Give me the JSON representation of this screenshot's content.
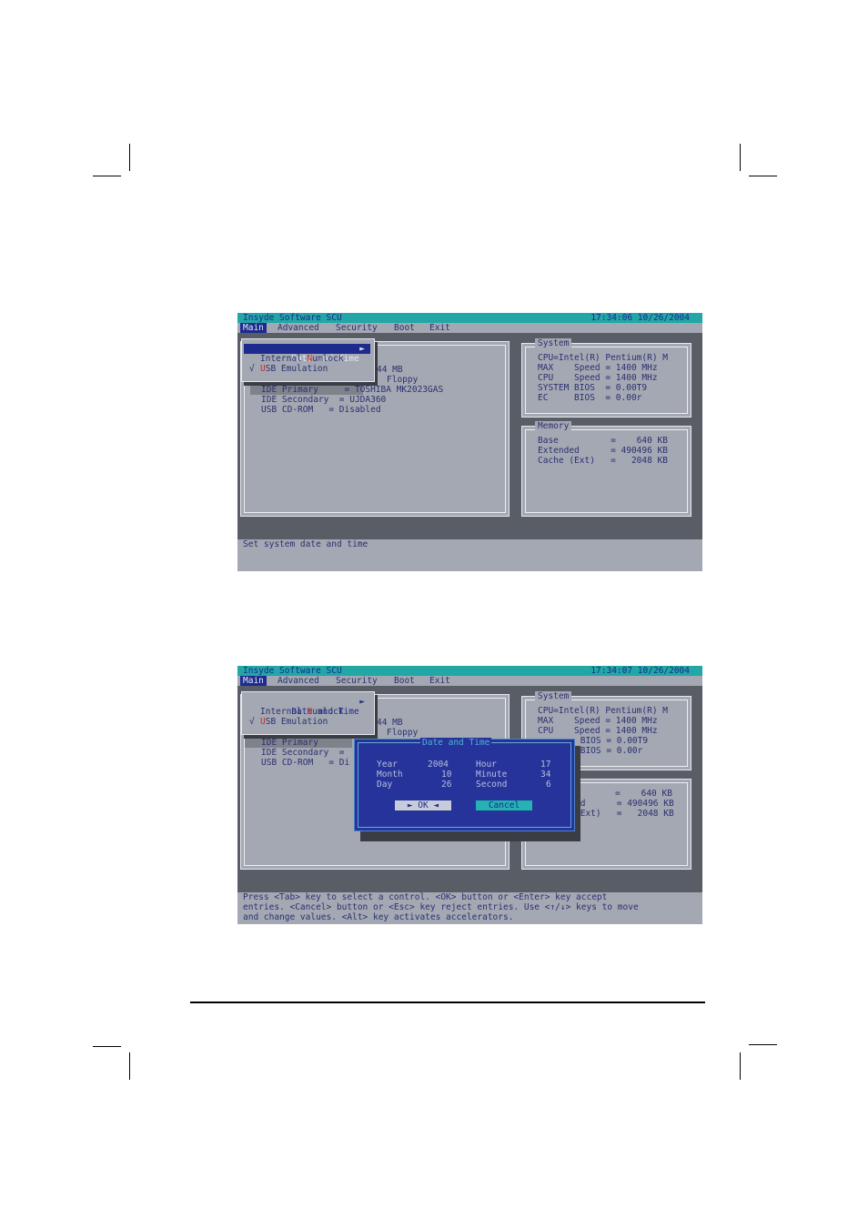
{
  "screen1": {
    "app_title": "Insyde Software SCU",
    "clock": "17:34:06  10/26/2004",
    "menu": [
      "Main",
      "Advanced",
      "Security",
      "Boot",
      "Exit"
    ],
    "dropdown": {
      "date_time": "Date and Time",
      "arrow": "►",
      "numlock_a": "Internal ",
      "numlock_b": "N",
      "numlock_c": "umlock",
      "check": "√",
      "usb_a": "U",
      "usb_b": "SB Emulation"
    },
    "left_rows": [
      "44 MB",
      "Floppy",
      "IDE Primary     = TOSHIBA MK2023GAS",
      "IDE Secondary  = UJDA360",
      "USB CD-ROM   = Disabled"
    ],
    "system": {
      "title": "System",
      "rows": [
        "CPU=Intel(R) Pentium(R) M",
        "MAX    Speed = 1400 MHz",
        "CPU    Speed = 1400 MHz",
        "SYSTEM BIOS  = 0.00T9",
        "EC     BIOS  = 0.00r"
      ]
    },
    "memory": {
      "title": "Memory",
      "rows": [
        "Base          =    640 KB",
        "Extended      = 490496 KB",
        "Cache (Ext)   =   2048 KB"
      ]
    },
    "status": [
      "Set system date and time"
    ]
  },
  "screen2": {
    "app_title": "Insyde Software SCU",
    "clock": "17:34:07  10/26/2004",
    "menu": [
      "Main",
      "Advanced",
      "Security",
      "Boot",
      "Exit"
    ],
    "left_rows": [
      "44 MB",
      "Floppy",
      "IDE Primary",
      "IDE Secondary  =",
      "USB CD-ROM   = Di"
    ],
    "system": {
      "title": "System",
      "rows": [
        "CPU=Intel(R) Pentium(R) M",
        "MAX    Speed = 1400 MHz",
        "CPU    Speed = 1400 MHz",
        " BIOS = 0.00T9",
        " BIOS = 0.00r"
      ]
    },
    "memory": {
      "rows": [
        "=    640 KB",
        "ed      = 490496 KB",
        "(Ext)   =   2048 KB"
      ]
    },
    "dialog": {
      "title": "Date and Time",
      "year_label": "Year",
      "year_value": "2004",
      "month_label": "Month",
      "month_value": "10",
      "day_label": "Day",
      "day_value": "26",
      "hour_label": "Hour",
      "hour_value": "17",
      "minute_label": "Minute",
      "minute_value": "34",
      "second_label": "Second",
      "second_value": "6",
      "ok_label": "► OK ◄",
      "cancel_label": "Cancel"
    },
    "status": [
      "Press <Tab> key to select a control. <OK> button or <Enter> key accept",
      "entries. <Cancel> button or <Esc> key reject entries. Use <↑/↓> keys to move",
      "and change values. <Alt> key activates accelerators."
    ]
  }
}
